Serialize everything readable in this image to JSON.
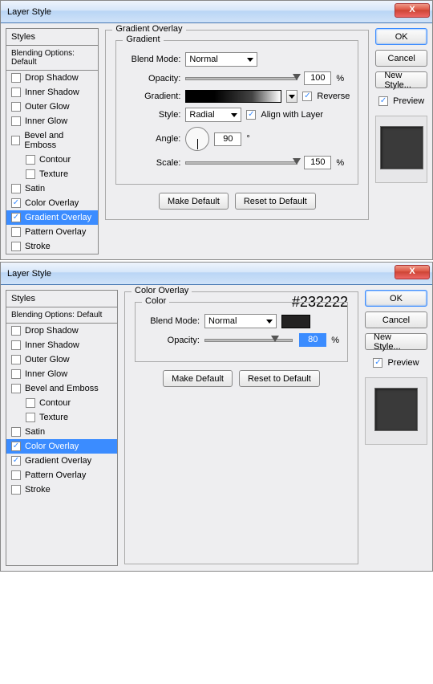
{
  "dialogs": [
    {
      "title": "Layer Style",
      "close": "X",
      "stylesHeader": "Styles",
      "blending": "Blending Options: Default",
      "items": [
        {
          "label": "Drop Shadow",
          "checked": false,
          "sel": false,
          "indent": false
        },
        {
          "label": "Inner Shadow",
          "checked": false,
          "sel": false,
          "indent": false
        },
        {
          "label": "Outer Glow",
          "checked": false,
          "sel": false,
          "indent": false
        },
        {
          "label": "Inner Glow",
          "checked": false,
          "sel": false,
          "indent": false
        },
        {
          "label": "Bevel and Emboss",
          "checked": false,
          "sel": false,
          "indent": false
        },
        {
          "label": "Contour",
          "checked": false,
          "sel": false,
          "indent": true
        },
        {
          "label": "Texture",
          "checked": false,
          "sel": false,
          "indent": true
        },
        {
          "label": "Satin",
          "checked": false,
          "sel": false,
          "indent": false
        },
        {
          "label": "Color Overlay",
          "checked": true,
          "sel": false,
          "indent": false
        },
        {
          "label": "Gradient Overlay",
          "checked": true,
          "sel": true,
          "indent": false
        },
        {
          "label": "Pattern Overlay",
          "checked": false,
          "sel": false,
          "indent": false
        },
        {
          "label": "Stroke",
          "checked": false,
          "sel": false,
          "indent": false
        }
      ],
      "panel": {
        "outerLegend": "Gradient Overlay",
        "innerLegend": "Gradient",
        "blendModeLabel": "Blend Mode:",
        "blendMode": "Normal",
        "opacityLabel": "Opacity:",
        "opacity": "100",
        "pct": "%",
        "gradientLabel": "Gradient:",
        "reverseLabel": "Reverse",
        "reverseChecked": true,
        "styleLabel": "Style:",
        "style": "Radial",
        "alignLabel": "Align with Layer",
        "alignChecked": true,
        "angleLabel": "Angle:",
        "angle": "90",
        "deg": "°",
        "scaleLabel": "Scale:",
        "scale": "150",
        "makeDefault": "Make Default",
        "resetDefault": "Reset to Default"
      },
      "right": {
        "ok": "OK",
        "cancel": "Cancel",
        "newStyle": "New Style...",
        "previewLabel": "Preview",
        "previewChecked": true
      }
    },
    {
      "title": "Layer Style",
      "close": "X",
      "stylesHeader": "Styles",
      "blending": "Blending Options: Default",
      "items": [
        {
          "label": "Drop Shadow",
          "checked": false,
          "sel": false,
          "indent": false
        },
        {
          "label": "Inner Shadow",
          "checked": false,
          "sel": false,
          "indent": false
        },
        {
          "label": "Outer Glow",
          "checked": false,
          "sel": false,
          "indent": false
        },
        {
          "label": "Inner Glow",
          "checked": false,
          "sel": false,
          "indent": false
        },
        {
          "label": "Bevel and Emboss",
          "checked": false,
          "sel": false,
          "indent": false
        },
        {
          "label": "Contour",
          "checked": false,
          "sel": false,
          "indent": true
        },
        {
          "label": "Texture",
          "checked": false,
          "sel": false,
          "indent": true
        },
        {
          "label": "Satin",
          "checked": false,
          "sel": false,
          "indent": false
        },
        {
          "label": "Color Overlay",
          "checked": true,
          "sel": true,
          "indent": false
        },
        {
          "label": "Gradient Overlay",
          "checked": true,
          "sel": false,
          "indent": false
        },
        {
          "label": "Pattern Overlay",
          "checked": false,
          "sel": false,
          "indent": false
        },
        {
          "label": "Stroke",
          "checked": false,
          "sel": false,
          "indent": false
        }
      ],
      "panel": {
        "outerLegend": "Color Overlay",
        "innerLegend": "Color",
        "blendModeLabel": "Blend Mode:",
        "blendMode": "Normal",
        "opacityLabel": "Opacity:",
        "opacity": "80",
        "pct": "%",
        "opacitySel": true,
        "colorHex": "#232222",
        "makeDefault": "Make Default",
        "resetDefault": "Reset to Default",
        "annotation": "#232222"
      },
      "right": {
        "ok": "OK",
        "cancel": "Cancel",
        "newStyle": "New Style...",
        "previewLabel": "Preview",
        "previewChecked": true
      }
    }
  ]
}
